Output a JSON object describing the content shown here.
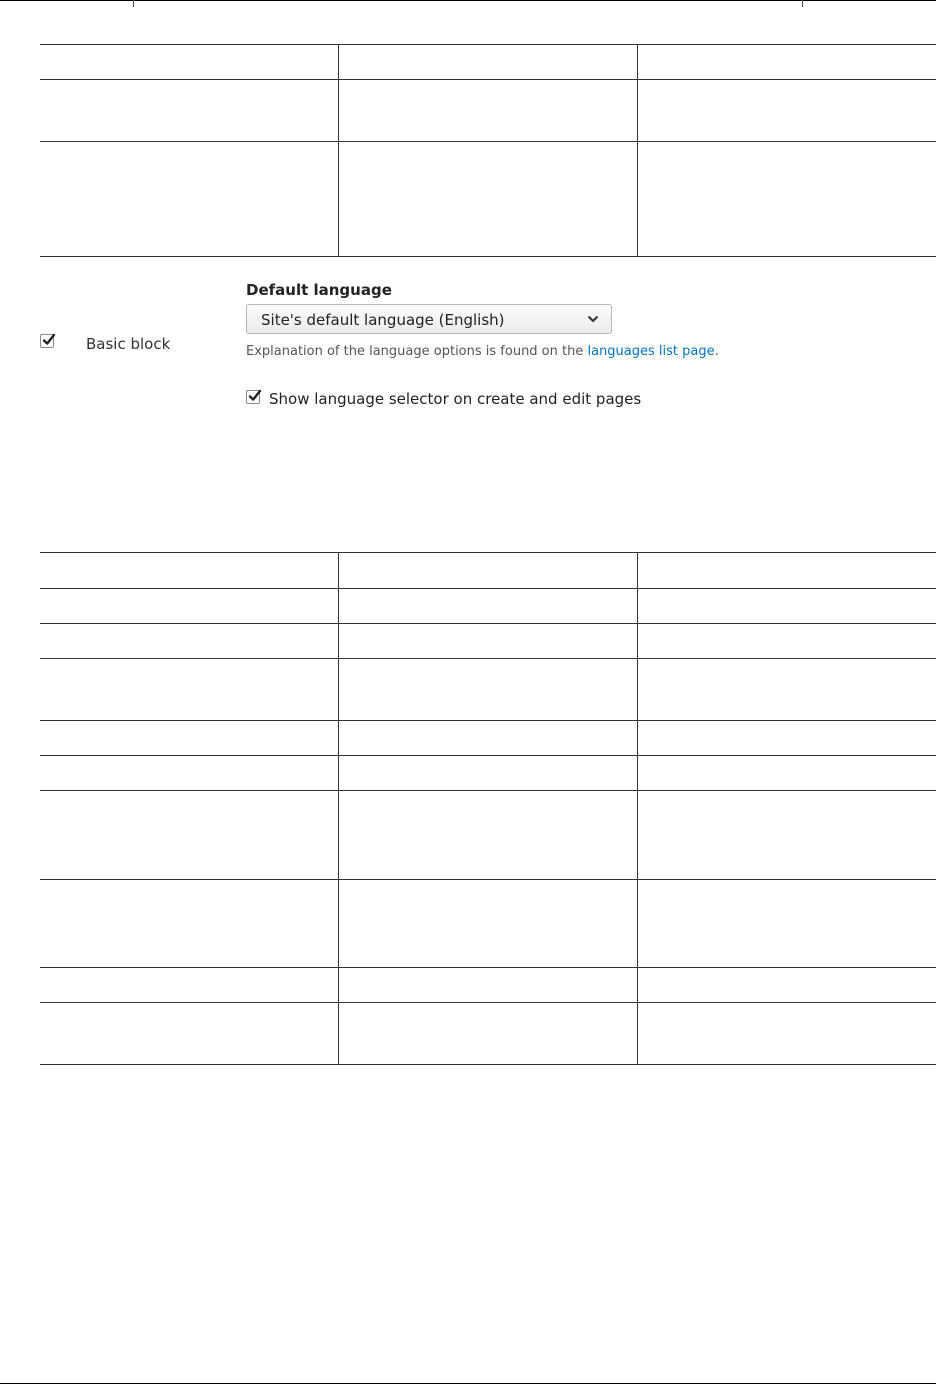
{
  "block_settings": {
    "bundle_checked": true,
    "bundle_label": "Basic block",
    "default_language_title": "Default language",
    "default_language_selected": "Site's default language (English)",
    "description_prefix": "Explanation of the language options is found on the ",
    "description_link": "languages list page",
    "description_suffix": ".",
    "show_selector_checked": true,
    "show_selector_label": "Show language selector on create and edit pages"
  },
  "icons": {
    "checkbox": "check-icon",
    "select": "chevron-down-icon"
  },
  "colors": {
    "link": "#0074bd",
    "text": "#333333",
    "border": "#333333"
  }
}
